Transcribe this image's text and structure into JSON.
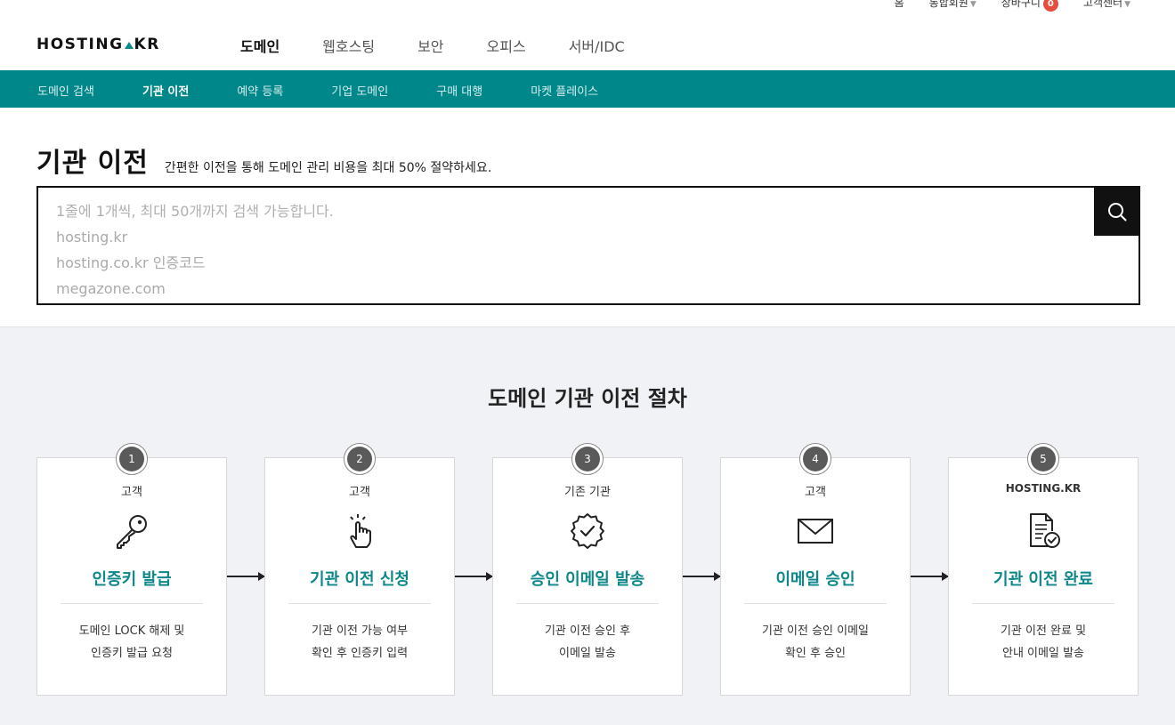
{
  "util_nav": [
    {
      "label": "홈",
      "caret": false
    },
    {
      "label": "통합회원",
      "caret": true
    },
    {
      "label": "장바구니",
      "caret": false,
      "badge": "0"
    },
    {
      "label": "고객센터",
      "caret": true
    }
  ],
  "logo": {
    "part1": "HOSTING",
    "part2": "KR"
  },
  "main_nav": [
    "도메인",
    "웹호스팅",
    "보안",
    "오피스",
    "서버/IDC"
  ],
  "sub_nav": [
    "도메인 검색",
    "기관 이전",
    "예약 등록",
    "기업 도메인",
    "구매 대행",
    "마켓 플레이스"
  ],
  "page": {
    "title": "기관 이전",
    "subtitle": "간편한 이전을 통해 도메인 관리 비용을 최대 50% 절약하세요."
  },
  "search": {
    "placeholder_lines": [
      "1줄에 1개씩, 최대 50개까지 검색 가능합니다.",
      "hosting.kr",
      "hosting.co.kr 인증코드",
      "megazone.com"
    ]
  },
  "process": {
    "heading": "도메인 기관 이전 절차",
    "steps": [
      {
        "num": "1",
        "who": "고객",
        "title": "인증키 발급",
        "desc1": "도메인 LOCK 해제 및",
        "desc2": "인증키 발급 요청",
        "icon": "key-icon"
      },
      {
        "num": "2",
        "who": "고객",
        "title": "기관 이전 신청",
        "desc1": "기관 이전 가능 여부",
        "desc2": "확인 후 인증키 입력",
        "icon": "hand-pointer-icon"
      },
      {
        "num": "3",
        "who": "기존 기관",
        "title": "승인 이메일 발송",
        "desc1": "기관 이전 승인 후",
        "desc2": "이메일 발송",
        "icon": "verified-badge-icon"
      },
      {
        "num": "4",
        "who": "고객",
        "title": "이메일 승인",
        "desc1": "기관 이전 승인 이메일",
        "desc2": "확인 후 승인",
        "icon": "envelope-icon"
      },
      {
        "num": "5",
        "who": "HOSTING.KR",
        "title": "기관 이전 완료",
        "desc1": "기관 이전 완료 및",
        "desc2": "안내 이메일 발송",
        "icon": "document-check-icon"
      }
    ]
  },
  "colors": {
    "teal": "#00878a",
    "title_teal": "#0e878a",
    "badge_red": "#e74c3c",
    "section_bg": "#f1f2f5"
  }
}
